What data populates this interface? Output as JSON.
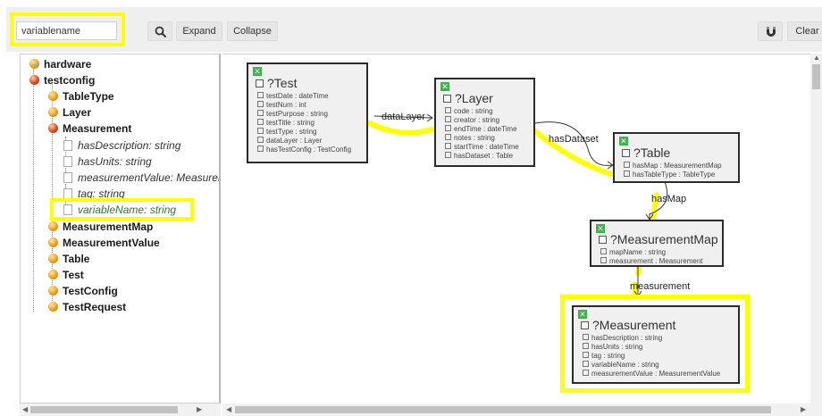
{
  "toolbar": {
    "search_value": "variablename",
    "expand_label": "Expand",
    "collapse_label": "Collapse",
    "clear_label": "Clear",
    "search_icon": "search-icon",
    "magnet_icon": "magnet-icon"
  },
  "tree": {
    "items": [
      {
        "label": "hardware",
        "icon": "class-ball-orange"
      },
      {
        "label": "testconfig",
        "icon": "class-ball-red"
      },
      {
        "label": "TableType",
        "icon": "class-ball-orange"
      },
      {
        "label": "Layer",
        "icon": "class-ball-orange"
      },
      {
        "label": "Measurement",
        "icon": "class-ball-red"
      },
      {
        "label": "hasDescription: string",
        "icon": "property-doc-icon"
      },
      {
        "label": "hasUnits: string",
        "icon": "property-doc-icon"
      },
      {
        "label": "measurementValue: MeasurementValue",
        "icon": "property-doc-icon"
      },
      {
        "label": "tag: string",
        "icon": "property-doc-icon"
      },
      {
        "label": "variableName: string",
        "icon": "property-doc-icon"
      },
      {
        "label": "MeasurementMap",
        "icon": "class-ball-orange"
      },
      {
        "label": "MeasurementValue",
        "icon": "class-ball-orange"
      },
      {
        "label": "Table",
        "icon": "class-ball-orange"
      },
      {
        "label": "Test",
        "icon": "class-ball-orange"
      },
      {
        "label": "TestConfig",
        "icon": "class-ball-orange"
      },
      {
        "label": "TestRequest",
        "icon": "class-ball-orange"
      }
    ]
  },
  "graph": {
    "nodes": [
      {
        "title": "?Test",
        "props": [
          "testDate : dateTime",
          "testNum : int",
          "testPurpose : string",
          "testTitle : string",
          "testType : string",
          "dataLayer : Layer",
          "hasTestConfig : TestConfig"
        ]
      },
      {
        "title": "?Layer",
        "props": [
          "code : string",
          "creator : string",
          "endTime : dateTime",
          "notes : string",
          "startTime : dateTime",
          "hasDataset : Table"
        ]
      },
      {
        "title": "?Table",
        "props": [
          "hasMap : MeasurementMap",
          "hasTableType : TableType"
        ]
      },
      {
        "title": "?MeasurementMap",
        "props": [
          "mapName : string",
          "measurement : Measurement"
        ]
      },
      {
        "title": "?Measurement",
        "props": [
          "hasDescription : string",
          "hasUnits : string",
          "tag : string",
          "variableName : string",
          "measurementValue : MeasurementValue"
        ]
      }
    ],
    "edges": [
      "dataLayer",
      "hasDataset",
      "hasMap",
      "measurement"
    ],
    "highlight_color": "#ffff00"
  }
}
